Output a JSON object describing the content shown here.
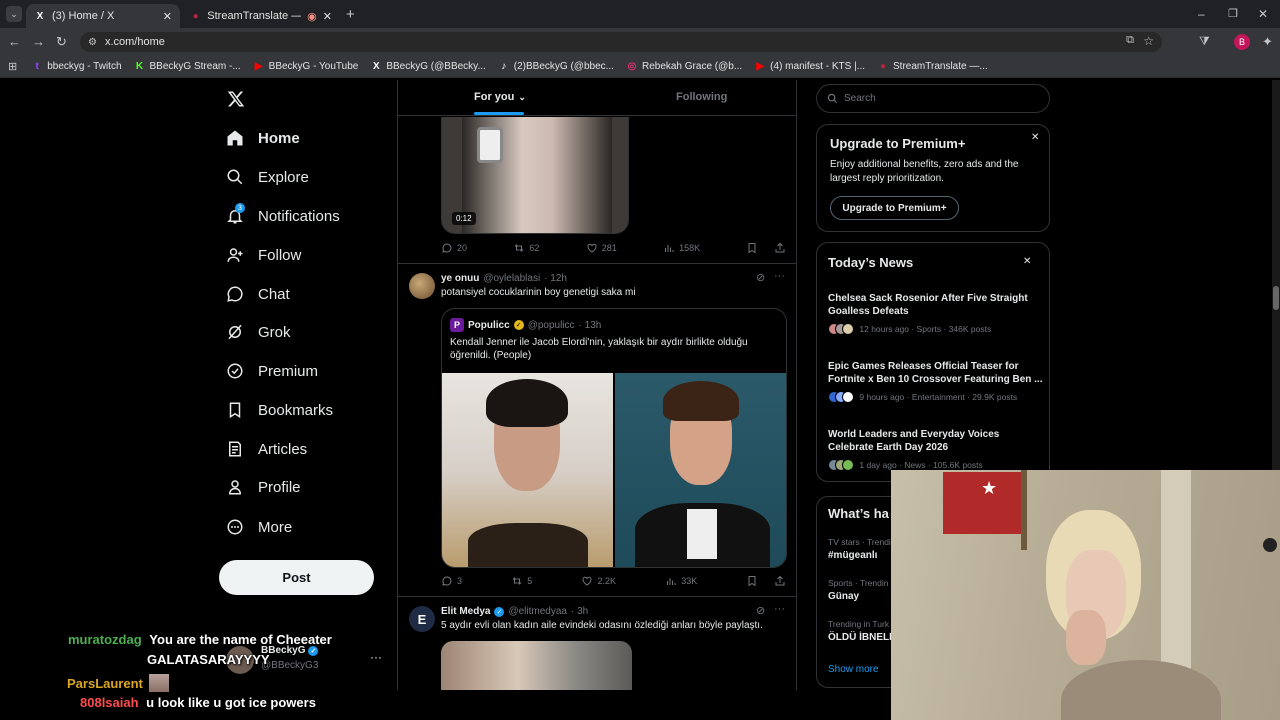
{
  "browser": {
    "tabs": [
      {
        "title": "(3) Home / X",
        "active": true
      },
      {
        "title": "StreamTranslate — Real-Tim",
        "active": false
      }
    ],
    "url": "x.com/home",
    "bookmarks": [
      {
        "label": "bbeckyg - Twitch",
        "color": "#9146ff",
        "glyph": "t"
      },
      {
        "label": "BBeckyG Stream -...",
        "color": "#53fc18",
        "glyph": "K"
      },
      {
        "label": "BBeckyG - YouTube",
        "color": "#ff0000",
        "glyph": "▶"
      },
      {
        "label": "BBeckyG (@BBecky...",
        "color": "#ffffff",
        "glyph": "X"
      },
      {
        "label": "(2)BBeckyG (@bbec...",
        "color": "#ffffff",
        "glyph": "♪"
      },
      {
        "label": "Rebekah Grace (@b...",
        "color": "#e1306c",
        "glyph": "◎"
      },
      {
        "label": "(4) manifest - KTS |...",
        "color": "#ff0000",
        "glyph": "▶"
      },
      {
        "label": "StreamTranslate —...",
        "color": "#b0283a",
        "glyph": "●"
      }
    ],
    "profile_initial": "B"
  },
  "nav": {
    "home": "Home",
    "explore": "Explore",
    "notifications": "Notifications",
    "notif_badge": "3",
    "follow": "Follow",
    "chat": "Chat",
    "grok": "Grok",
    "premium": "Premium",
    "bookmarks": "Bookmarks",
    "articles": "Articles",
    "profile": "Profile",
    "more": "More",
    "post": "Post",
    "account_name": "BBeckyG",
    "account_handle": "@BBeckyG3"
  },
  "feed": {
    "tab_foryou": "For you",
    "tab_following": "Following",
    "post1": {
      "duration": "0:12",
      "replies": "20",
      "reposts": "62",
      "likes": "281",
      "views": "158K"
    },
    "post2": {
      "author": "ye onuu",
      "handle": "@oylelablasi",
      "time": "· 12h",
      "text": "potansiyel cocuklarinin boy genetigi saka mi",
      "quote_author": "Populicc",
      "quote_handle": "@populicc",
      "quote_time": "· 13h",
      "quote_text": "Kendall Jenner ile Jacob Elordi'nin, yaklaşık bir aydır birlikte olduğu öğrenildi. (People)",
      "replies": "3",
      "reposts": "5",
      "likes": "2.2K",
      "views": "33K"
    },
    "post3": {
      "author": "Elit Medya",
      "handle": "@elitmedyaa",
      "time": "· 3h",
      "avatar_letter": "E",
      "text": "5 aydır evli olan kadın aile evindeki odasını özlediği anları böyle paylaştı."
    }
  },
  "right": {
    "search_placeholder": "Search",
    "premium_title": "Upgrade to Premium+",
    "premium_text": "Enjoy additional benefits, zero ads and the largest reply prioritization.",
    "premium_button": "Upgrade to Premium+",
    "news_title": "Today’s News",
    "news": [
      {
        "title": "Chelsea Sack Rosenior After Five Straight Goalless Defeats",
        "meta": "12 hours ago · Sports · 346K posts"
      },
      {
        "title": "Epic Games Releases Official Teaser for Fortnite x Ben 10 Crossover Featuring Ben ...",
        "meta": "9 hours ago · Entertainment · 29.9K posts"
      },
      {
        "title": "World Leaders and Everyday Voices Celebrate Earth Day 2026",
        "meta": "1 day ago · News · 105.6K posts"
      }
    ],
    "happening_title": "What’s ha",
    "trends": [
      {
        "meta": "TV stars · Trendi",
        "name": "#mügeanlı"
      },
      {
        "meta": "Sports · Trendin",
        "name": "Günay"
      },
      {
        "meta": "Trending in Turk",
        "name": "ÖLDÜ İBNELE"
      }
    ],
    "show_more": "Show more"
  },
  "chat": [
    {
      "user": "muratozdag",
      "color": "#4caf50",
      "message": "You are the name of Cheeater"
    },
    {
      "user": "",
      "color": "#ffffff",
      "message": "GALATASARAYYYY"
    },
    {
      "user": "ParsLaurent",
      "color": "#daa520",
      "message": ""
    },
    {
      "user": "808lsaiah",
      "color": "#ff4d4d",
      "message": "u look like u got ice powers"
    }
  ]
}
